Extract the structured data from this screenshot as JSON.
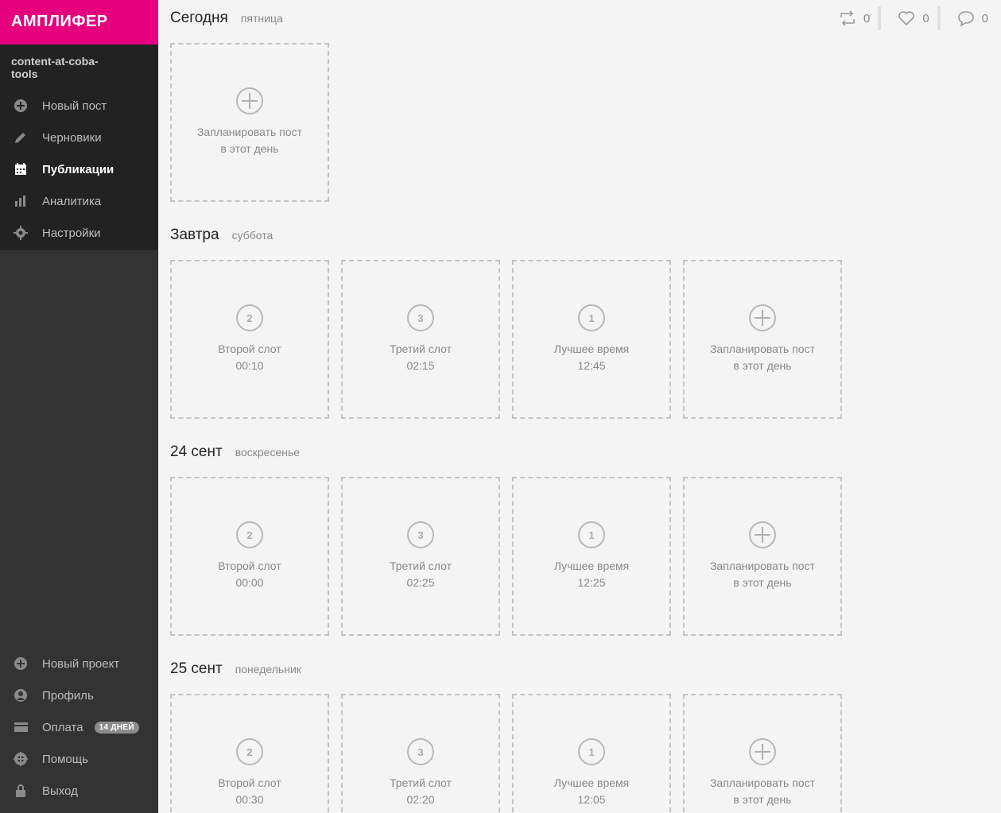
{
  "brand": "АМПЛИФЕР",
  "project_name": "content-at-coba-tools",
  "nav": [
    {
      "label": "Новый пост",
      "icon": "plus-circle-icon"
    },
    {
      "label": "Черновики",
      "icon": "pencil-icon"
    },
    {
      "label": "Публикации",
      "icon": "calendar-icon",
      "active": true
    },
    {
      "label": "Аналитика",
      "icon": "bar-chart-icon"
    },
    {
      "label": "Настройки",
      "icon": "gear-icon"
    }
  ],
  "bottom_nav": [
    {
      "label": "Новый проект",
      "icon": "plus-circle-icon"
    },
    {
      "label": "Профиль",
      "icon": "user-icon"
    },
    {
      "label": "Оплата",
      "icon": "credit-card-icon",
      "badge": "14 ДНЕЙ"
    },
    {
      "label": "Помощь",
      "icon": "lifebuoy-icon"
    },
    {
      "label": "Выход",
      "icon": "lock-icon"
    }
  ],
  "stats": {
    "reposts": "0",
    "likes": "0",
    "comments": "0"
  },
  "add_slot": {
    "line1": "Запланировать пост",
    "line2": "в этот день"
  },
  "days": [
    {
      "title": "Сегодня",
      "sub": "пятница",
      "slots": []
    },
    {
      "title": "Завтра",
      "sub": "суббота",
      "slots": [
        {
          "num": "2",
          "name": "Второй слот",
          "time": "00:10"
        },
        {
          "num": "3",
          "name": "Третий слот",
          "time": "02:15"
        },
        {
          "num": "1",
          "name": "Лучшее время",
          "time": "12:45"
        }
      ]
    },
    {
      "title": "24 сент",
      "sub": "воскресенье",
      "slots": [
        {
          "num": "2",
          "name": "Второй слот",
          "time": "00:00"
        },
        {
          "num": "3",
          "name": "Третий слот",
          "time": "02:25"
        },
        {
          "num": "1",
          "name": "Лучшее время",
          "time": "12:25"
        }
      ]
    },
    {
      "title": "25 сент",
      "sub": "понедельник",
      "slots": [
        {
          "num": "2",
          "name": "Второй слот",
          "time": "00:30"
        },
        {
          "num": "3",
          "name": "Третий слот",
          "time": "02:20"
        },
        {
          "num": "1",
          "name": "Лучшее время",
          "time": "12:05"
        }
      ]
    }
  ]
}
